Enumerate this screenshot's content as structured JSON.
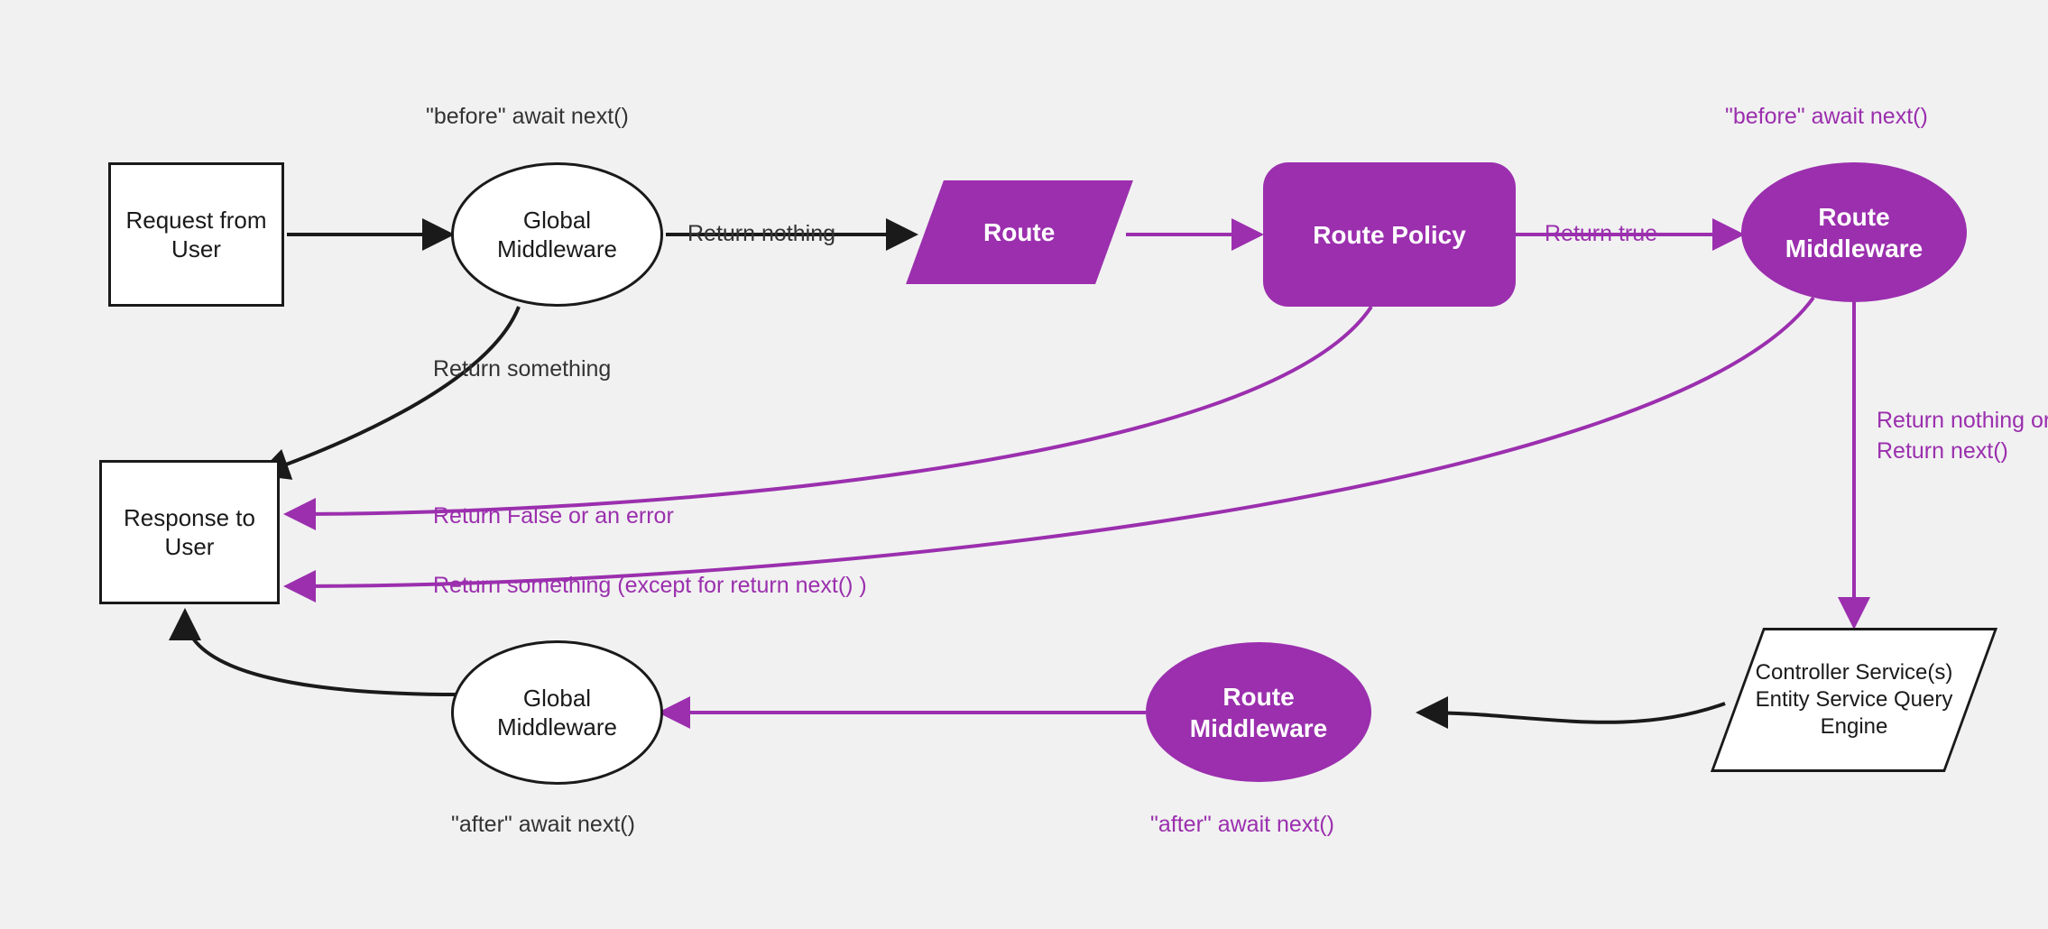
{
  "colors": {
    "accent": "#9b2fae",
    "ink": "#1a1a1a",
    "bg": "#f1f1f1"
  },
  "nodes": {
    "request": "Request from User",
    "global_mw_top": "Global Middleware",
    "route": "Route",
    "route_policy": "Route Policy",
    "route_mw_top": "Route Middleware",
    "controller": "Controller Service(s) Entity Service Query Engine",
    "route_mw_bottom": "Route Middleware",
    "global_mw_bottom": "Global Middleware",
    "response": "Response to User"
  },
  "labels": {
    "before_await_next_top_left": "\"before\" await next()",
    "before_await_next_top_right": "\"before\" await next()",
    "return_nothing": "Return nothing",
    "return_true": "Return true",
    "return_nothing_or_next": "Return nothing or Return next()",
    "return_something": "Return something",
    "return_false_or_error": "Return False or an error",
    "return_something_except_next": "Return something (except for return next() )",
    "after_await_next_left": "\"after\" await next()",
    "after_await_next_right": "\"after\" await next()"
  },
  "chart_data": {
    "type": "flowchart",
    "nodes": [
      {
        "id": "request",
        "label": "Request from User",
        "shape": "rect"
      },
      {
        "id": "global_mw_top",
        "label": "Global Middleware",
        "shape": "ellipse",
        "note": "\"before\" await next()"
      },
      {
        "id": "route",
        "label": "Route",
        "shape": "parallelogram",
        "fill": "#9b2fae"
      },
      {
        "id": "route_policy",
        "label": "Route Policy",
        "shape": "rounded-rect",
        "fill": "#9b2fae"
      },
      {
        "id": "route_mw_top",
        "label": "Route Middleware",
        "shape": "ellipse",
        "fill": "#9b2fae",
        "note": "\"before\" await next()"
      },
      {
        "id": "controller",
        "label": "Controller Service(s) Entity Service Query Engine",
        "shape": "parallelogram"
      },
      {
        "id": "route_mw_bottom",
        "label": "Route Middleware",
        "shape": "ellipse",
        "fill": "#9b2fae",
        "note": "\"after\" await next()"
      },
      {
        "id": "global_mw_bottom",
        "label": "Global Middleware",
        "shape": "ellipse",
        "note": "\"after\" await next()"
      },
      {
        "id": "response",
        "label": "Response to User",
        "shape": "rect"
      }
    ],
    "edges": [
      {
        "from": "request",
        "to": "global_mw_top",
        "color": "#1a1a1a"
      },
      {
        "from": "global_mw_top",
        "to": "route",
        "label": "Return nothing",
        "color": "#1a1a1a"
      },
      {
        "from": "global_mw_top",
        "to": "response",
        "label": "Return something",
        "color": "#1a1a1a"
      },
      {
        "from": "route",
        "to": "route_policy",
        "color": "#9b2fae"
      },
      {
        "from": "route_policy",
        "to": "route_mw_top",
        "label": "Return true",
        "color": "#9b2fae"
      },
      {
        "from": "route_policy",
        "to": "response",
        "label": "Return False or an error",
        "color": "#9b2fae"
      },
      {
        "from": "route_mw_top",
        "to": "controller",
        "label": "Return nothing or Return next()",
        "color": "#9b2fae"
      },
      {
        "from": "route_mw_top",
        "to": "response",
        "label": "Return something (except for return next() )",
        "color": "#9b2fae"
      },
      {
        "from": "controller",
        "to": "route_mw_bottom",
        "color": "#1a1a1a"
      },
      {
        "from": "route_mw_bottom",
        "to": "global_mw_bottom",
        "color": "#9b2fae"
      },
      {
        "from": "global_mw_bottom",
        "to": "response",
        "color": "#1a1a1a"
      }
    ]
  }
}
